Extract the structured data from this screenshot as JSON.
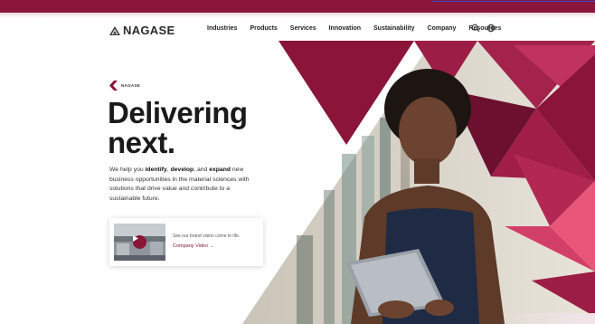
{
  "brand": {
    "name": "NAGASE",
    "accent": "#8a1538",
    "accent_light": "#e8577a"
  },
  "nav": {
    "items": [
      "Industries",
      "Products",
      "Services",
      "Innovation",
      "Sustainability",
      "Company",
      "Resources"
    ],
    "icons": [
      "search-icon",
      "globe-icon"
    ]
  },
  "hero": {
    "eyebrow": "NAGASE",
    "headline_line1": "Delivering",
    "headline_line2": "next.",
    "intro_1": "We help you ",
    "intro_identify": "identify",
    "intro_2": ", ",
    "intro_develop": "develop",
    "intro_3": ", and ",
    "intro_expand": "expand",
    "intro_4": " new business opportunities in the material sciences with solutions that drive value and contribute to a sustainable future."
  },
  "video_card": {
    "text": "See our brand vision come to life.",
    "link": "Company Video →"
  }
}
